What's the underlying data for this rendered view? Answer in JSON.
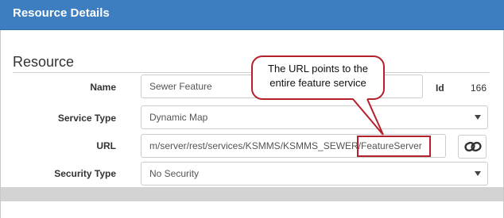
{
  "header": {
    "title": "Resource Details"
  },
  "section": {
    "title": "Resource"
  },
  "form": {
    "name_label": "Name",
    "name_value": "Sewer Feature",
    "id_label": "Id",
    "id_value": "166",
    "service_type_label": "Service Type",
    "service_type_value": "Dynamic Map",
    "url_label": "URL",
    "url_value_prefix": "m/server/rest/services/KSMMS/KSMMS_SEWER/",
    "url_value_highlight": "FeatureServer",
    "security_type_label": "Security Type",
    "security_type_value": "No Security"
  },
  "callout": {
    "text_line1": "The URL points to the",
    "text_line2": "entire feature service"
  },
  "colors": {
    "header": "#3c7ebf",
    "callout_border": "#b5202a"
  },
  "icons": {
    "link_button": "link-icon",
    "select_caret": "caret-down-icon"
  }
}
